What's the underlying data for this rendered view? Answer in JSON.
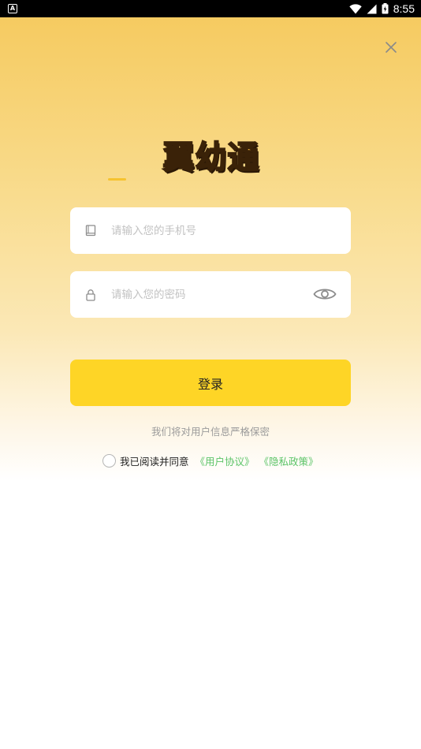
{
  "status_bar": {
    "notification_icon": "A",
    "time": "8:55"
  },
  "logo": {
    "text": "翼幼通"
  },
  "phone_input": {
    "placeholder": "请输入您的手机号",
    "value": ""
  },
  "password_input": {
    "placeholder": "请输入您的密码",
    "value": ""
  },
  "login_button": {
    "label": "登录"
  },
  "privacy_note": "我们将对用户信息严格保密",
  "agreement": {
    "text": "我已阅读并同意",
    "user_agreement": "《用户协议》",
    "privacy_policy": "《隐私政策》"
  },
  "colors": {
    "accent": "#fed526",
    "link": "#5cc468",
    "gradient_top": "#f5c95c"
  },
  "icons": {
    "close": "close-icon",
    "phone": "phone-book-icon",
    "lock": "lock-icon",
    "eye": "eye-icon",
    "wifi": "wifi-icon",
    "signal": "signal-icon",
    "battery": "battery-icon"
  }
}
